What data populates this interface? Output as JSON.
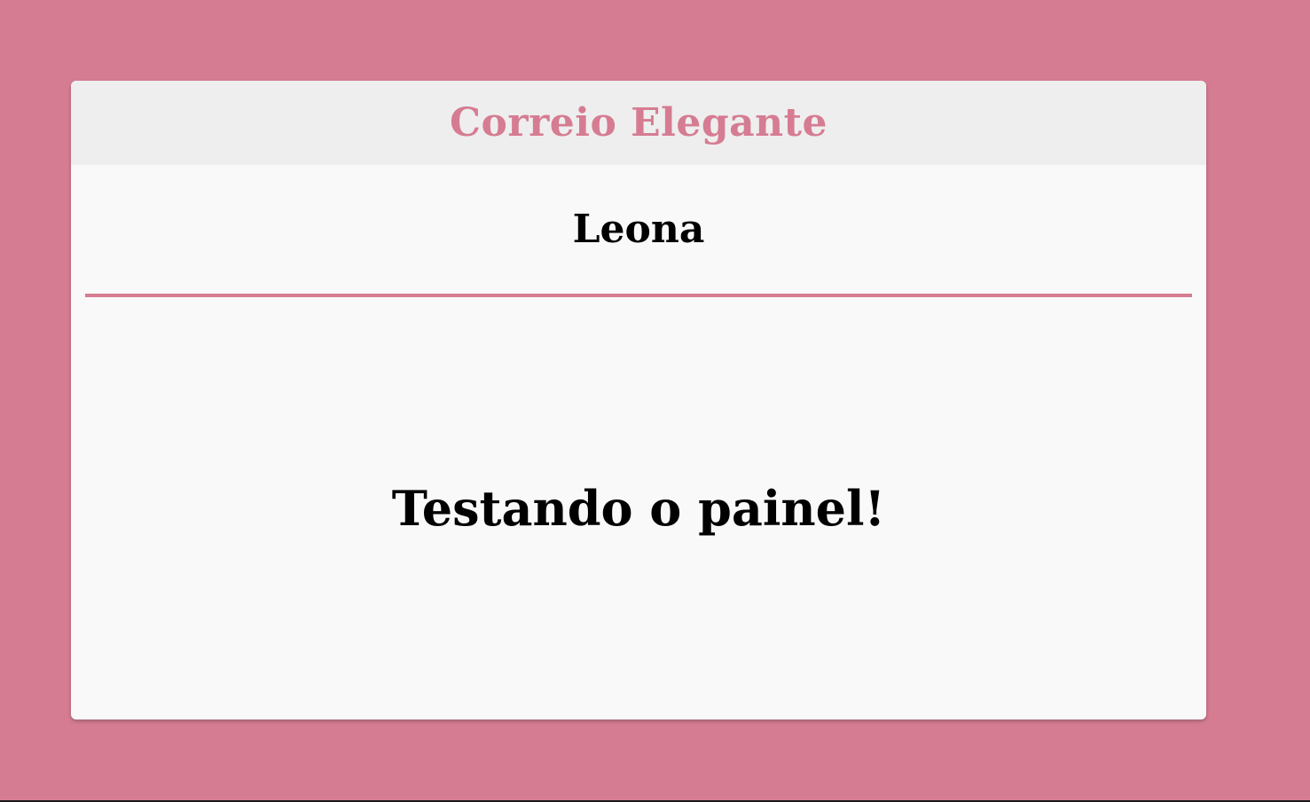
{
  "header": {
    "title": "Correio Elegante"
  },
  "card": {
    "recipient": "Leona",
    "message": "Testando o painel!"
  },
  "colors": {
    "background": "#d67c92",
    "accent": "#d67c92",
    "card": "#f9f9f9",
    "header": "#eeeeee"
  }
}
